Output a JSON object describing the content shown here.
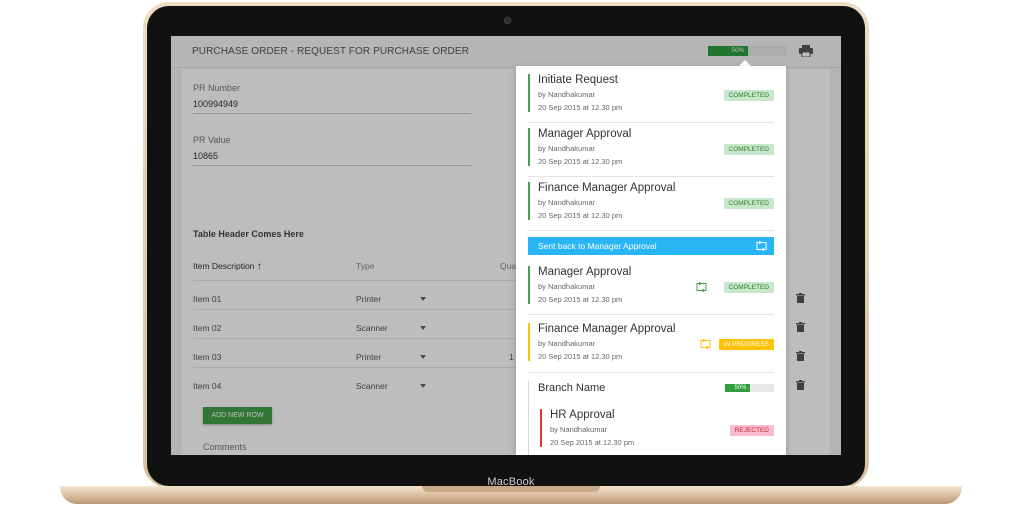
{
  "device": {
    "brand": "MacBook"
  },
  "header": {
    "title": "PURCHASE ORDER - REQUEST FOR PURCHASE ORDER",
    "progress": {
      "value": 0.5,
      "label": "50%"
    },
    "print_icon": "printer-icon"
  },
  "form": {
    "pr_number": {
      "label": "PR Number",
      "value": "100994949"
    },
    "pr_value": {
      "label": "PR Value",
      "value": "10865"
    },
    "table_header": "Table Header Comes Here",
    "columns": {
      "item_description": "Item Description",
      "type": "Type",
      "quantity": "Qua"
    },
    "rows": [
      {
        "item": "Item 01",
        "type": "Printer",
        "qty": ""
      },
      {
        "item": "Item 02",
        "type": "Scanner",
        "qty": ""
      },
      {
        "item": "Item 03",
        "type": "Printer",
        "qty": "1"
      },
      {
        "item": "Item 04",
        "type": "Scanner",
        "qty": ""
      }
    ],
    "add_row_label": "ADD NEW ROW",
    "comments_label": "Comments"
  },
  "timeline": {
    "steps": [
      {
        "name": "Initiate Request",
        "by": "by Nandhakumar",
        "date": "20 Sep 2015 at 12.30 pm",
        "status": "COMPLETED",
        "status_type": "completed",
        "color": "#43a047"
      },
      {
        "name": "Manager Approval",
        "by": "by Nandhakumar",
        "date": "20 Sep 2015 at 12.30 pm",
        "status": "COMPLETED",
        "status_type": "completed",
        "color": "#43a047"
      },
      {
        "name": "Finance Manager Approval",
        "by": "by Nandhakumar",
        "date": "20 Sep 2015 at 12.30 pm",
        "status": "COMPLETED",
        "status_type": "completed",
        "color": "#43a047"
      }
    ],
    "sent_back": {
      "label": "Sent back to Manager Approval",
      "color": "#29b6f6"
    },
    "resubmitted_steps": [
      {
        "name": "Manager Approval",
        "by": "by Nandhakumar",
        "date": "20 Sep 2015 at 12.30 pm",
        "status": "COMPLETED",
        "status_type": "completed",
        "color": "#43a047"
      },
      {
        "name": "Finance Manager Approval",
        "by": "by Nandhakumar",
        "date": "20 Sep 2015 at 12.30 pm",
        "status": "IN PROGRESS",
        "status_type": "progress",
        "color": "#ffc107"
      }
    ],
    "branch": {
      "name": "Branch Name",
      "progress": {
        "value": 0.5,
        "label": "50%"
      },
      "steps": [
        {
          "name": "HR Approval",
          "by": "by Nandhakumar",
          "date": "20 Sep 2015 at 12.30 pm",
          "status": "REJECTED",
          "status_type": "rejected",
          "color": "#e53935"
        }
      ]
    }
  }
}
